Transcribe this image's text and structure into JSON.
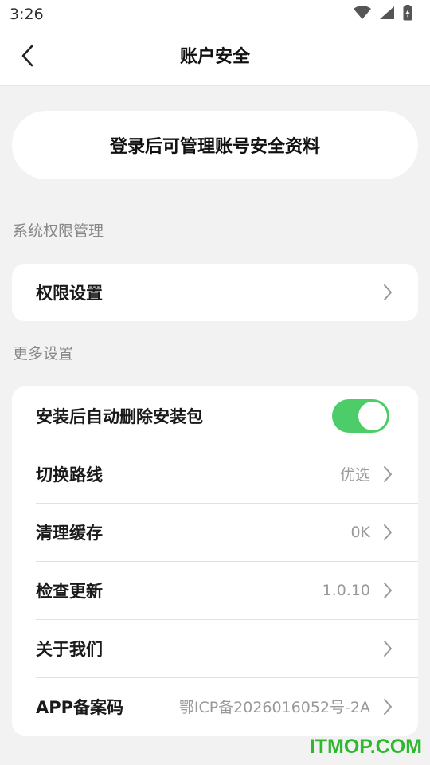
{
  "status_bar": {
    "time": "3:26",
    "icons": [
      "wifi-icon",
      "cellular-signal-icon",
      "battery-charging-icon"
    ]
  },
  "navbar": {
    "back_icon": "chevron-left-icon",
    "title": "账户安全"
  },
  "login_banner": {
    "label": "登录后可管理账号安全资料"
  },
  "sections": {
    "permissions": {
      "header": "系统权限管理",
      "items": [
        {
          "label": "权限设置",
          "value": ""
        }
      ]
    },
    "more": {
      "header": "更多设置",
      "items": [
        {
          "label": "安装后自动删除安装包",
          "value": "",
          "toggle_on": true
        },
        {
          "label": "切换路线",
          "value": "优选"
        },
        {
          "label": "清理缓存",
          "value": "0K"
        },
        {
          "label": "检查更新",
          "value": "1.0.10"
        },
        {
          "label": "关于我们",
          "value": ""
        },
        {
          "label": "APP备案码",
          "value": "鄂ICP备2026016052号-2A"
        }
      ]
    }
  },
  "watermark": "ITMOP.COM",
  "colors": {
    "background": "#f2f2f2",
    "card": "#ffffff",
    "toggle_on": "#4ccd6a",
    "secondary_text": "#999999",
    "watermark": "#2eb82e"
  }
}
